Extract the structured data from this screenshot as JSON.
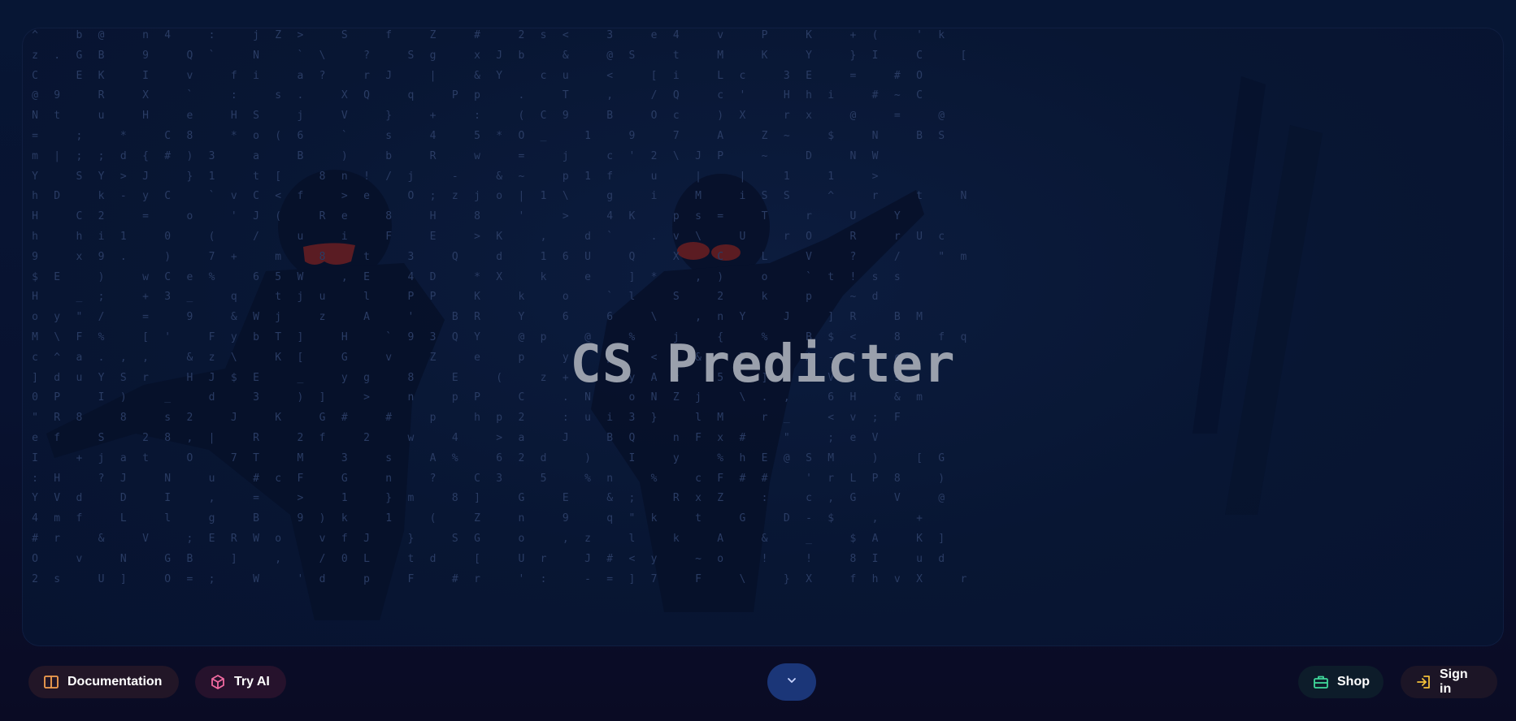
{
  "hero": {
    "title": "CS Predicter"
  },
  "matrix_rows": [
    "^  b @  n 4  :  j Z >  S  f  Z  #  2 s <  3  e 4  v  P  K  + (  ' k",
    "z . G B  9  Q `  N  ` \\  ?  S g  x J b  &  @ S  t  M  K  Y  } I  C  [",
    "C  E K  I  v  f i  a ?  r J  |  & Y  c u  <  [ i  L c  3 E  =  # O",
    "@ 9  R  X  `  :  s .  X Q  q  P p  .  T  ,  / Q  c '  H h i  # ~ C",
    "N t  u  H  e  H S  j  V  }  +  :  ( C 9  B  O c  ) X  r x  @  =  @",
    "=  ;  *  C 8  * o ( 6  `  s  4  5 * O _  1  9  7  A  Z ~  $  N  B S",
    "m | ; ; d { # ) 3  a  B  )  b  R  w  =  j  c ' 2 \\ J P  ~  D  N W",
    "Y  S Y > J  } 1  t [  8 n ! / j  -  & ~  p 1 f  u  |  |  1  1  >",
    "h D  k - y C  ` v C < f  > e  O ; z j o | 1 \\  g  i  M  i S S  ^  r  t  N",
    "H  C 2  =  o  ' J (  R e  8  H  8  '  >  4 K  p s =  T  r  U  Y",
    "h  h i 1  0  (  /  u  i  F  E  > K  ,  d `  . v \\  U  r O  R  r U c",
    "9  x 9 .  )  7 +  m  8  t  3  Q  d  1 6 U  Q  X  C  L  V  ?  /  \" m",
    "$ E  )  w C e %  6 5 W  , E  4 D  * X  k  e  ] *  , )  o  ` t ! s s",
    "H  _ ;  + 3 _  q  t j u  l  P P  K  k  o  ` l  S  2  k  p  ~ d",
    "o y \" /  =  9  & W j  z  A  '  B R  Y  6  6  \\  , n Y  J  ] R  B M",
    "M \\ F %  [ '  F y b T ]  H  ` 9 3 Q Y  @ p  @  %  j  {  %  B $ <  8  f q",
    "c ^ a . , ,  & z \\  K [  G  v  Z  e  p  y  p  <  &  D  ) A - {  c",
    "] d u Y S r  H J $ E  _  y g  8  E  (  z + >  y A c  5  ] O  V  ! s",
    "0 P  I )  _  d  3  ) ]  >  n  p P  C  . N  o N Z j  \\ . ,  6 H  & m",
    "\" R 8  8  s 2  J  K  G #  #  p  h p 2  : u i 3 }  l M  r _  < v ; F",
    "e f  S  2 8 , |  R  2 f  2  w  4  > a  J  B Q  n F x #  \"  ; e V",
    "I  + j a t  O  7 T  M  3  s  A %  6 2 d  )  I  y  % h E @ S M  )  [ G",
    ": H  ? J  N  u  # c F  G  n  ?  C 3  5  % n  %  c F # #  ' r L P 8  )",
    "Y V d  D  I  ,  =  >  1  } m  8 ]  G  E  & ;  R x Z  :  c , G  V  @",
    "4 m f  L  l  g  B  9 ) k  1  (  Z  n  9  q \" k  t  G  D - $  ,  +",
    "# r  &  V  ; E R W o  v f J  }  S G  o  , z  l  k  A  &  _  $ A  K ]",
    "O  v  N  G B  ]  ,  / 0 L  t d  [  U r  J # < y  ~ o  !  !  8 I  u d",
    "2 s  U ]  O = ;  W  ' d  p  F  # r  ' :  - = ] 7  F  \\  } X  f h v X  r"
  ],
  "footer": {
    "docs_label": "Documentation",
    "try_ai_label": "Try AI",
    "shop_label": "Shop",
    "signin_label": "Sign in"
  },
  "icons": {
    "docs": "book-icon",
    "try_ai": "cube-icon",
    "scroll": "chevron-down-icon",
    "shop": "briefcase-icon",
    "signin": "sign-in-icon"
  },
  "colors": {
    "docs_icon": "#f5a050",
    "try_ai_icon": "#f06aa0",
    "shop_icon": "#3fd79a",
    "signin_icon": "#f2c03a",
    "scroll_button": "#1b3678"
  }
}
